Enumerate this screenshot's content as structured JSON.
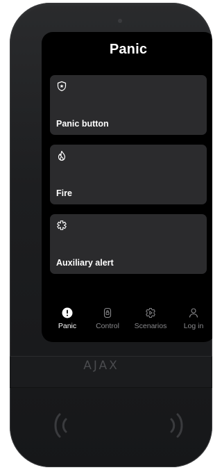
{
  "screen": {
    "title": "Panic"
  },
  "cards": [
    {
      "label": "Panic button",
      "icon": "shield-star-icon"
    },
    {
      "label": "Fire",
      "icon": "flame-icon"
    },
    {
      "label": "Auxiliary alert",
      "icon": "medical-cross-icon"
    }
  ],
  "nav": {
    "items": [
      {
        "label": "Panic",
        "icon": "alert-circle-icon",
        "active": true
      },
      {
        "label": "Control",
        "icon": "lock-badge-icon",
        "active": false
      },
      {
        "label": "Scenarios",
        "icon": "play-gear-icon",
        "active": false
      },
      {
        "label": "Log in",
        "icon": "user-icon",
        "active": false
      }
    ]
  },
  "device": {
    "brand": "AJAX"
  },
  "colors": {
    "screen_bg": "#000000",
    "card_bg": "#2b2b2d",
    "text_active": "#ffffff",
    "text_inactive": "#8a8a8d",
    "body": "#1d1e20"
  }
}
